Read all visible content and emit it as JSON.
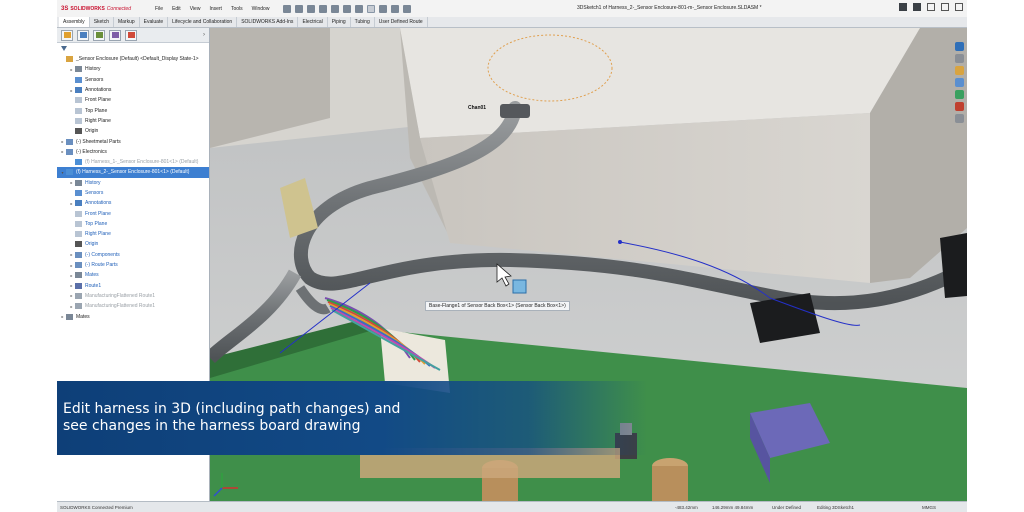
{
  "app": {
    "brand_ds": "3S",
    "brand_name": "SOLIDWORKS",
    "brand_suffix": "Connected",
    "document_title": "3DSketch1 of Harness_2-_Sensor Enclosure-801-m-_Sensor Enclosure.SLDASM *",
    "menus": [
      "File",
      "Edit",
      "View",
      "Insert",
      "Tools",
      "Window"
    ]
  },
  "command_tabs": [
    "Assembly",
    "Sketch",
    "Markup",
    "Evaluate",
    "Lifecycle and Collaboration",
    "SOLIDWORKS Add-Ins",
    "Electrical",
    "Piping",
    "Tubing",
    "User Defined Route"
  ],
  "feature_tree": [
    {
      "label": "_Sensor Enclosure (Default) <Default_Display State-1>",
      "level": 0,
      "exp": "",
      "icon": "assembly-icon",
      "style": ""
    },
    {
      "label": "History",
      "level": 1,
      "exp": "▸",
      "icon": "history-icon",
      "style": ""
    },
    {
      "label": "Sensors",
      "level": 1,
      "exp": "",
      "icon": "sensors-icon",
      "style": ""
    },
    {
      "label": "Annotations",
      "level": 1,
      "exp": "▸",
      "icon": "annotations-icon",
      "style": ""
    },
    {
      "label": "Front Plane",
      "level": 1,
      "exp": "",
      "icon": "plane-icon",
      "style": ""
    },
    {
      "label": "Top Plane",
      "level": 1,
      "exp": "",
      "icon": "plane-icon",
      "style": ""
    },
    {
      "label": "Right Plane",
      "level": 1,
      "exp": "",
      "icon": "plane-icon",
      "style": ""
    },
    {
      "label": "Origin",
      "level": 1,
      "exp": "",
      "icon": "origin-icon",
      "style": ""
    },
    {
      "label": "(-) Sheetmetal Parts",
      "level": 0,
      "exp": "▸",
      "icon": "folder-icon",
      "style": ""
    },
    {
      "label": "(-) Electronics",
      "level": 0,
      "exp": "▸",
      "icon": "folder-icon",
      "style": ""
    },
    {
      "label": "(f) Harness_1-_Sensor Enclosure-801<1> (Default)",
      "level": 1,
      "exp": "",
      "icon": "harness-icon",
      "style": "grey"
    },
    {
      "label": "(f) Harness_2-_Sensor Enclosure-801<1> (Default)",
      "level": 0,
      "exp": "▾",
      "icon": "harness-icon",
      "style": "sel"
    },
    {
      "label": "History",
      "level": 1,
      "exp": "▸",
      "icon": "history-icon",
      "style": "blue"
    },
    {
      "label": "Sensors",
      "level": 1,
      "exp": "",
      "icon": "sensors-icon",
      "style": "blue"
    },
    {
      "label": "Annotations",
      "level": 1,
      "exp": "▸",
      "icon": "annotations-icon",
      "style": "blue"
    },
    {
      "label": "Front Plane",
      "level": 1,
      "exp": "",
      "icon": "plane-icon",
      "style": "blue"
    },
    {
      "label": "Top Plane",
      "level": 1,
      "exp": "",
      "icon": "plane-icon",
      "style": "blue"
    },
    {
      "label": "Right Plane",
      "level": 1,
      "exp": "",
      "icon": "plane-icon",
      "style": "blue"
    },
    {
      "label": "Origin",
      "level": 1,
      "exp": "",
      "icon": "origin-icon",
      "style": "blue"
    },
    {
      "label": "(-) Components",
      "level": 1,
      "exp": "▸",
      "icon": "folder-icon",
      "style": "blue"
    },
    {
      "label": "(-) Route Parts",
      "level": 1,
      "exp": "▸",
      "icon": "folder-icon",
      "style": "blue"
    },
    {
      "label": "Mates",
      "level": 1,
      "exp": "▸",
      "icon": "mates-icon",
      "style": "blue"
    },
    {
      "label": "Route1",
      "level": 1,
      "exp": "▸",
      "icon": "route-icon",
      "style": "blue"
    },
    {
      "label": "ManufacturingFlattened Route1",
      "level": 1,
      "exp": "▸",
      "icon": "flatten-icon",
      "style": "grey"
    },
    {
      "label": "ManufacturingFlattened Route1",
      "level": 1,
      "exp": "▸",
      "icon": "flatten-icon",
      "style": "grey"
    },
    {
      "label": "Mates",
      "level": 0,
      "exp": "▸",
      "icon": "mates-icon",
      "style": ""
    }
  ],
  "viewport": {
    "connector_label": "Chan01",
    "tooltip": "Base-Flange1 of Sensor Back Box<1> (Sensor Back Box<1>)"
  },
  "caption": {
    "line1": "Edit harness in 3D (including path changes) and",
    "line2": "see changes in the harness board drawing"
  },
  "status": {
    "product": "SOLIDWORKS Connected Premium",
    "x": "-483.42mm",
    "y": "146.29mm 49.84mm",
    "state": "Under Defined",
    "editing": "Editing 3DSketch1",
    "units": "MMGS"
  },
  "colors": {
    "accent": "#3d7fd1",
    "brand": "#c8102e",
    "caption_bg": "#124a86"
  }
}
